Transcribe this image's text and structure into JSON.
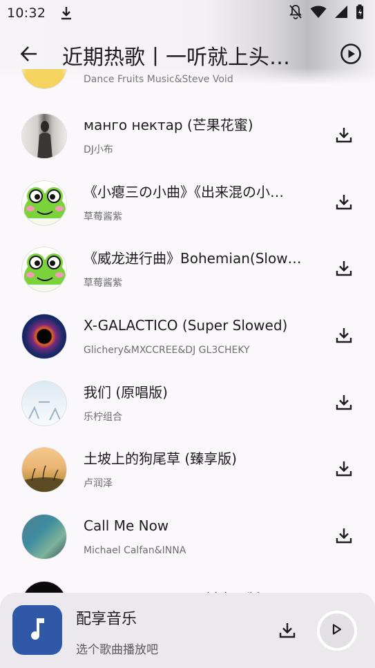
{
  "status_bar": {
    "time": "10:32",
    "icons": [
      "download-icon",
      "notifications-off-icon",
      "wifi-icon",
      "signal-icon",
      "battery-charging-icon"
    ]
  },
  "header": {
    "title": "近期热歌丨一听就上头…",
    "back_icon": "arrow-back-icon",
    "play_all_icon": "play-circle-icon"
  },
  "partial_top_artist": "Dance Fruits Music&Steve Void",
  "songs": [
    {
      "title": "манго нектар (芒果花蜜)",
      "artist": "DJ小布",
      "avatar": "photo-person"
    },
    {
      "title": "《小瘪三の小曲》《出来混の小…",
      "artist": "草莓酱紫",
      "avatar": "frog-cartoon"
    },
    {
      "title": "《威龙进行曲》Bohemian(Slow…",
      "artist": "草莓酱紫",
      "avatar": "frog-cartoon"
    },
    {
      "title": "X-GALACTICO (Super Slowed)",
      "artist": "Glichery&MXCCREE&DJ GL3CHEKY",
      "avatar": "black-hole"
    },
    {
      "title": "我们 (原唱版)",
      "artist": "乐柠组合",
      "avatar": "winter-sketch"
    },
    {
      "title": "土坡上的狗尾草 (臻享版)",
      "artist": "卢润泽",
      "avatar": "sunset-field"
    },
    {
      "title": "Call Me Now",
      "artist": "Michael Calfan&INNA",
      "avatar": "blue-green-blur"
    },
    {
      "title": "Normal No More (抖音原版)",
      "artist": "",
      "avatar": "black"
    }
  ],
  "player": {
    "name": "配享音乐",
    "hint": "选个歌曲播放吧",
    "art_icon": "music-note-icon",
    "colors": {
      "art": "#2f58a7"
    }
  }
}
